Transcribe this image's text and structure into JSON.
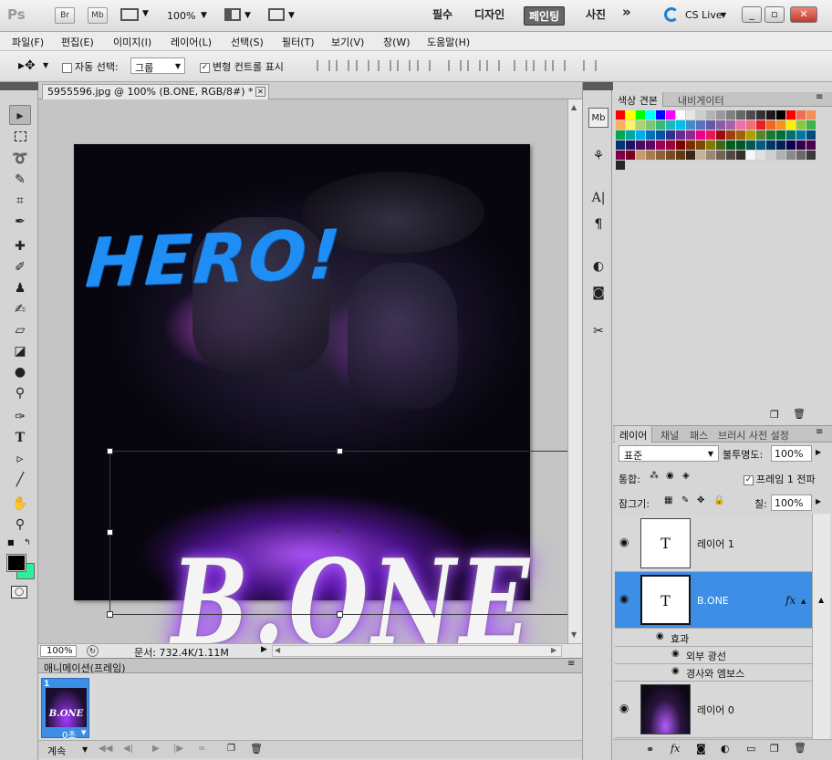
{
  "app": {
    "logo": "Ps",
    "bridge": "Br",
    "minibridge": "Mb",
    "zoom": "100%",
    "workspaces": [
      "필수",
      "디자인",
      "페인팅",
      "사진"
    ],
    "active_workspace": "페인팅",
    "more": "»",
    "cslive": "CS Live"
  },
  "menu": [
    "파일(F)",
    "편집(E)",
    "이미지(I)",
    "레이어(L)",
    "선택(S)",
    "필터(T)",
    "보기(V)",
    "창(W)",
    "도움말(H)"
  ],
  "options": {
    "auto_select_label": "자동 선택:",
    "auto_select_value": "그룹",
    "transform_controls": "변형 컨트롤 표시",
    "transform_checked": "✓"
  },
  "document": {
    "tab_title": "5955596.jpg @ 100% (B.ONE, RGB/8#) *",
    "hero_text": "HERO!",
    "main_text": "B.ONE",
    "zoom": "100%",
    "doc_info": "문서: 732.4K/1.11M"
  },
  "animation": {
    "title": "애니메이션(프레임)",
    "frame_number": "1",
    "frame_thumb_text": "B.ONE",
    "frame_delay": "0초",
    "loop": "계속"
  },
  "swatches": {
    "tabs": [
      "색상 견본",
      "내비게이터"
    ],
    "colors": [
      "#ff0000",
      "#ffff00",
      "#00ff00",
      "#00ffff",
      "#0000ff",
      "#ff00ff",
      "#ffffff",
      "#e6e6e6",
      "#cccccc",
      "#b3b3b3",
      "#999999",
      "#808080",
      "#666666",
      "#4d4d4d",
      "#333333",
      "#1a1a1a",
      "#000000",
      "#ff0000",
      "#f26c4f",
      "#f68e56",
      "#fbaf5d",
      "#fff467",
      "#acd372",
      "#7cc576",
      "#3bb878",
      "#1abbb4",
      "#00bff3",
      "#438ccb",
      "#5574b9",
      "#605ca8",
      "#855fa8",
      "#a763a8",
      "#f06ea9",
      "#f26d7d",
      "#ed1c24",
      "#f26522",
      "#f7941d",
      "#fff200",
      "#8dc73f",
      "#39b54a",
      "#00a651",
      "#00a99d",
      "#00aeef",
      "#0072bc",
      "#0054a6",
      "#2e3192",
      "#662d91",
      "#92278f",
      "#ec008c",
      "#ed145b",
      "#9e0b0f",
      "#a0410d",
      "#a3620a",
      "#aba000",
      "#598527",
      "#1a7b30",
      "#007236",
      "#00746b",
      "#0076a3",
      "#004a80",
      "#003471",
      "#1b1464",
      "#440e62",
      "#630460",
      "#9e005d",
      "#9e0039",
      "#790000",
      "#7b2e00",
      "#7d4900",
      "#827b00",
      "#406618",
      "#005e20",
      "#005826",
      "#005952",
      "#005b7f",
      "#003663",
      "#002157",
      "#0d004c",
      "#32004b",
      "#4b0049",
      "#7b0046",
      "#7a0026",
      "#c69c6d",
      "#a67c52",
      "#8c6239",
      "#754c24",
      "#603913",
      "#3c2415",
      "#c7b299",
      "#998675",
      "#736357",
      "#534741",
      "#37302a",
      "#f7f7f7",
      "#e0e0e0",
      "#cfcfcf",
      "#b0b0b0",
      "#8a8a8a",
      "#6a6a6a",
      "#3a3a3a",
      "#262626"
    ]
  },
  "layers_panel": {
    "tabs": [
      "레이어",
      "채널",
      "패스",
      "브러시 사전 설정"
    ],
    "blend_mode": "표준",
    "opacity_label": "불투명도:",
    "opacity": "100%",
    "unify_label": "통합:",
    "propagate_label": "프레임 1 전파",
    "propagate_checked": "✓",
    "lock_label": "잠그기:",
    "fill_label": "칠:",
    "fill": "100%",
    "layers": [
      {
        "name": "레이어 1",
        "thumb": "T"
      },
      {
        "name": "B.ONE",
        "thumb": "T",
        "fx": "fx"
      },
      {
        "name": "레이어 0"
      }
    ],
    "effects_label": "효과",
    "effects": [
      "외부 광선",
      "경사와 엠보스"
    ]
  }
}
